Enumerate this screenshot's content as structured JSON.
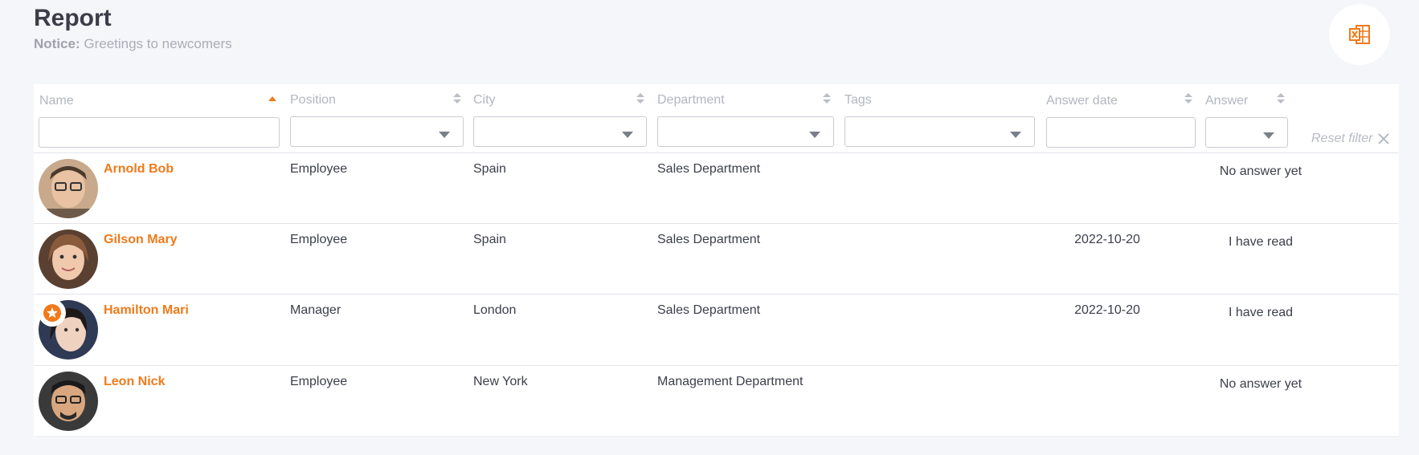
{
  "header": {
    "title": "Report",
    "notice_label": "Notice:",
    "notice_text": "Greetings to newcomers",
    "export_icon": "excel-export-icon"
  },
  "colors": {
    "accent": "#f07a1a",
    "background": "#f5f6f9",
    "muted": "#b2b6c0"
  },
  "table": {
    "columns": [
      {
        "key": "name",
        "label": "Name",
        "sort": "ascending"
      },
      {
        "key": "position",
        "label": "Position",
        "sort": "none"
      },
      {
        "key": "city",
        "label": "City",
        "sort": "none"
      },
      {
        "key": "department",
        "label": "Department",
        "sort": "none"
      },
      {
        "key": "tags",
        "label": "Tags",
        "sort": "none"
      },
      {
        "key": "answer_date",
        "label": "Answer date",
        "sort": "none"
      },
      {
        "key": "answer",
        "label": "Answer",
        "sort": "none"
      }
    ],
    "filters": {
      "name": "",
      "position": "",
      "city": "",
      "department": "",
      "tags": "",
      "answer_date": "",
      "answer": ""
    },
    "reset_label": "Reset filter",
    "rows": [
      {
        "name": "Arnold Bob",
        "position": "Employee",
        "city": "Spain",
        "department": "Sales Department",
        "tags": "",
        "answer_date": "",
        "answer": "No answer yet",
        "starred": false
      },
      {
        "name": "Gilson Mary",
        "position": "Employee",
        "city": "Spain",
        "department": "Sales Department",
        "tags": "",
        "answer_date": "2022-10-20",
        "answer": "I have read",
        "starred": false
      },
      {
        "name": "Hamilton Mari",
        "position": "Manager",
        "city": "London",
        "department": "Sales Department",
        "tags": "",
        "answer_date": "2022-10-20",
        "answer": "I have read",
        "starred": true
      },
      {
        "name": "Leon Nick",
        "position": "Employee",
        "city": "New York",
        "department": "Management Department",
        "tags": "",
        "answer_date": "",
        "answer": "No answer yet",
        "starred": false
      }
    ]
  }
}
